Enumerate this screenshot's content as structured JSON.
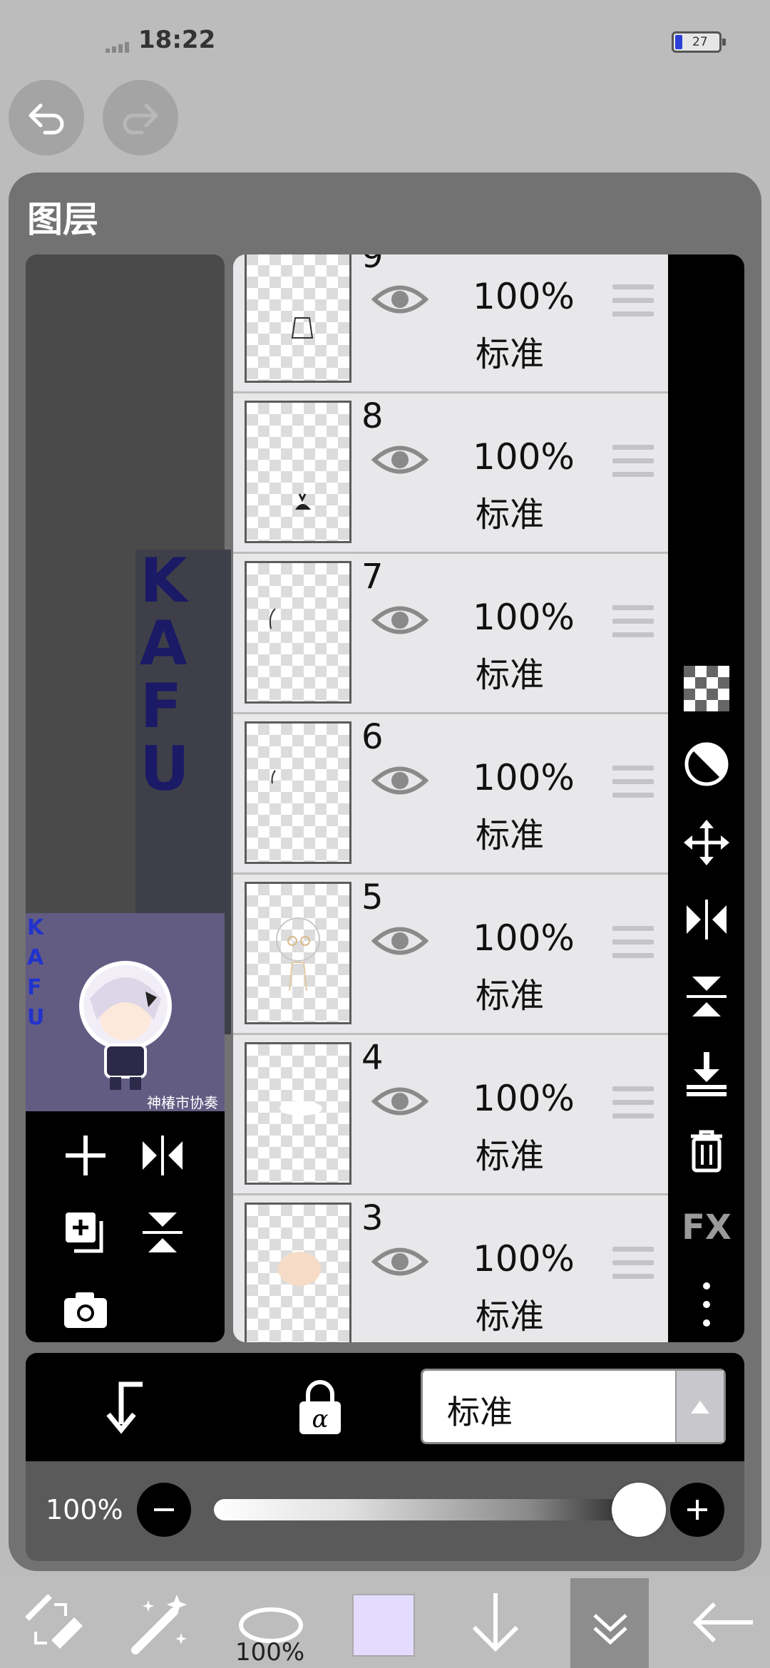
{
  "status": {
    "time": "18:22",
    "battery": "27"
  },
  "panel": {
    "title": "图层"
  },
  "preview": {
    "side_text": "KAFU",
    "caption": "神椿市协奏中"
  },
  "thumb_strip_text": "KAFU",
  "layers": [
    {
      "number": "9",
      "opacity": "100%",
      "mode": "标准"
    },
    {
      "number": "8",
      "opacity": "100%",
      "mode": "标准"
    },
    {
      "number": "7",
      "opacity": "100%",
      "mode": "标准"
    },
    {
      "number": "6",
      "opacity": "100%",
      "mode": "标准"
    },
    {
      "number": "5",
      "opacity": "100%",
      "mode": "标准"
    },
    {
      "number": "4",
      "opacity": "100%",
      "mode": "标准"
    },
    {
      "number": "3",
      "opacity": "100%",
      "mode": "标准"
    }
  ],
  "right_tools": {
    "fx": "FX",
    "icons": [
      "checker-icon",
      "contrast-icon",
      "move-icon",
      "flip-horizontal-icon",
      "flip-vertical-icon",
      "merge-down-icon",
      "trash-icon",
      "fx-label",
      "more-icon"
    ]
  },
  "blend": {
    "mode": "标准"
  },
  "opacity_slider": {
    "label": "100%",
    "value": 100
  },
  "bottom_toolbar": {
    "brush_size": "100%",
    "color": "#e4dcff"
  },
  "colors": {
    "panel": "#727272",
    "list_bg": "#e8e8ea",
    "accent_battery": "#2b3fd6"
  }
}
